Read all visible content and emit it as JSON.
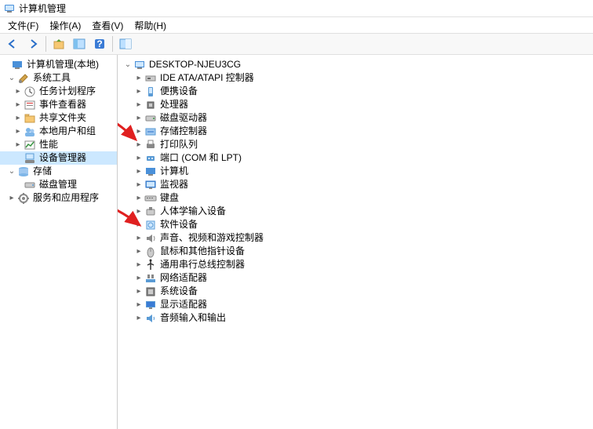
{
  "window": {
    "title": "计算机管理"
  },
  "menu": {
    "file": "文件(F)",
    "action": "操作(A)",
    "view": "查看(V)",
    "help": "帮助(H)"
  },
  "left_tree": {
    "root": "计算机管理(本地)",
    "system_tools": "系统工具",
    "task_scheduler": "任务计划程序",
    "event_viewer": "事件查看器",
    "shared_folders": "共享文件夹",
    "local_users": "本地用户和组",
    "performance": "性能",
    "device_manager": "设备管理器",
    "storage": "存储",
    "disk_mgmt": "磁盘管理",
    "services": "服务和应用程序"
  },
  "right_tree": {
    "root": "DESKTOP-NJEU3CG",
    "items": [
      "IDE ATA/ATAPI 控制器",
      "便携设备",
      "处理器",
      "磁盘驱动器",
      "存储控制器",
      "打印队列",
      "端口 (COM 和 LPT)",
      "计算机",
      "监视器",
      "键盘",
      "人体学输入设备",
      "软件设备",
      "声音、视频和游戏控制器",
      "鼠标和其他指针设备",
      "通用串行总线控制器",
      "网络适配器",
      "系统设备",
      "显示适配器",
      "音频输入和输出"
    ]
  },
  "icons": {
    "ide": "ide-icon",
    "portable": "portable-icon",
    "cpu": "cpu-icon",
    "disk": "disk-icon",
    "storage": "storage-ctrl-icon",
    "printer": "printer-icon",
    "port": "port-icon",
    "computer": "computer-icon",
    "monitor": "monitor-icon",
    "keyboard": "keyboard-icon",
    "hid": "hid-icon",
    "software": "software-icon",
    "sound": "sound-icon",
    "mouse": "mouse-icon",
    "usb": "usb-icon",
    "network": "network-icon",
    "system": "system-icon",
    "display": "display-icon",
    "audio": "audio-icon"
  }
}
